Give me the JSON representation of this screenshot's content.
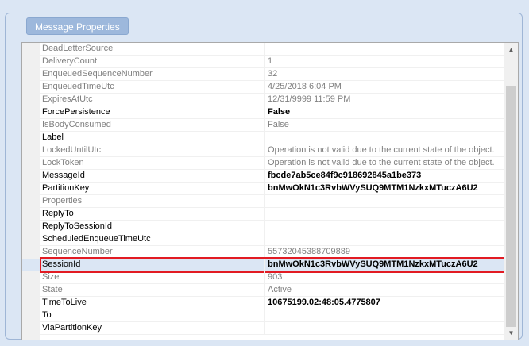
{
  "panel": {
    "title": "Message Properties"
  },
  "properties": [
    {
      "name": "DeadLetterSource",
      "value": "",
      "readonly": true
    },
    {
      "name": "DeliveryCount",
      "value": "1",
      "readonly": true
    },
    {
      "name": "EnqueuedSequenceNumber",
      "value": "32",
      "readonly": true
    },
    {
      "name": "EnqueuedTimeUtc",
      "value": "4/25/2018 6:04 PM",
      "readonly": true
    },
    {
      "name": "ExpiresAtUtc",
      "value": "12/31/9999 11:59 PM",
      "readonly": true
    },
    {
      "name": "ForcePersistence",
      "value": "False",
      "readonly": false,
      "bold": true
    },
    {
      "name": "IsBodyConsumed",
      "value": "False",
      "readonly": true
    },
    {
      "name": "Label",
      "value": "",
      "readonly": false
    },
    {
      "name": "LockedUntilUtc",
      "value": "Operation is not valid due to the current state of the object.",
      "readonly": true
    },
    {
      "name": "LockToken",
      "value": "Operation is not valid due to the current state of the object.",
      "readonly": true
    },
    {
      "name": "MessageId",
      "value": "fbcde7ab5ce84f9c918692845a1be373",
      "readonly": false,
      "bold": true
    },
    {
      "name": "PartitionKey",
      "value": "bnMwOkN1c3RvbWVySUQ9MTM1NzkxMTuczA6U2",
      "readonly": false,
      "bold": true
    },
    {
      "name": "Properties",
      "value": "",
      "readonly": true
    },
    {
      "name": "ReplyTo",
      "value": "",
      "readonly": false
    },
    {
      "name": "ReplyToSessionId",
      "value": "",
      "readonly": false
    },
    {
      "name": "ScheduledEnqueueTimeUtc",
      "value": "",
      "readonly": false
    },
    {
      "name": "SequenceNumber",
      "value": "55732045388709889",
      "readonly": true
    },
    {
      "name": "SessionId",
      "value": "bnMwOkN1c3RvbWVySUQ9MTM1NzkxMTuczA6U2",
      "readonly": false,
      "bold": true,
      "selected": true
    },
    {
      "name": "Size",
      "value": "903",
      "readonly": true
    },
    {
      "name": "State",
      "value": "Active",
      "readonly": true
    },
    {
      "name": "TimeToLive",
      "value": "10675199.02:48:05.4775807",
      "readonly": false,
      "bold": true
    },
    {
      "name": "To",
      "value": "",
      "readonly": false
    },
    {
      "name": "ViaPartitionKey",
      "value": "",
      "readonly": false
    }
  ],
  "scrollbar": {
    "up_glyph": "▲",
    "down_glyph": "▼"
  },
  "colors": {
    "highlight": "#e21b23",
    "header": "#9db8dc",
    "selected_row": "#dbe6f4"
  }
}
